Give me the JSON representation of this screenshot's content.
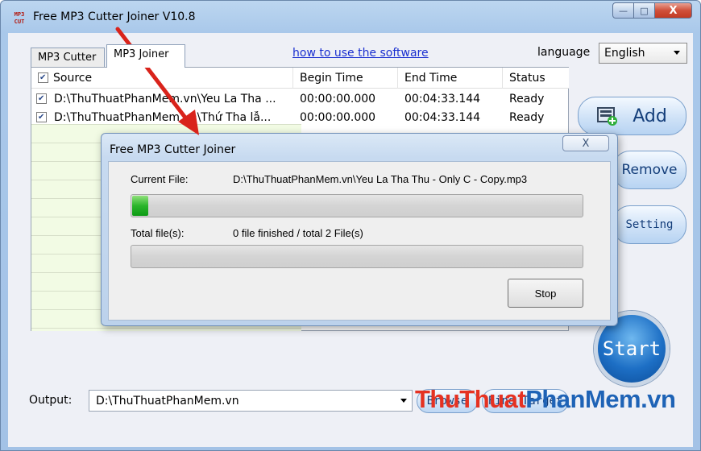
{
  "window": {
    "icon_text": "MP3\nCUT",
    "title": "Free MP3 Cutter Joiner V10.8",
    "controls": {
      "minimize": "—",
      "maximize": "□",
      "close": "X"
    }
  },
  "tabs": [
    {
      "label": "MP3 Cutter",
      "active": false
    },
    {
      "label": "MP3 Joiner",
      "active": true
    }
  ],
  "help_link": "how to use the software",
  "language": {
    "label": "language",
    "value": "English"
  },
  "table": {
    "header_checked": true,
    "columns": [
      "Source",
      "Begin Time",
      "End Time",
      "Status"
    ],
    "rows": [
      {
        "checked": true,
        "source": "D:\\ThuThuatPhanMem.vn\\Yeu La Tha ...",
        "begin": "00:00:00.000",
        "end": "00:04:33.144",
        "status": "Ready"
      },
      {
        "checked": true,
        "source": "D:\\ThuThuatPhanMem.vn\\Thứ Tha lẫ...",
        "begin": "00:00:00.000",
        "end": "00:04:33.144",
        "status": "Ready"
      }
    ]
  },
  "buttons": {
    "add": "Add",
    "remove": "Remove",
    "setting": "Setting",
    "start": "Start",
    "browse": "Browse",
    "find_target": "Find Target"
  },
  "output": {
    "label": "Output:",
    "value": "D:\\ThuThuatPhanMem.vn"
  },
  "dialog": {
    "title": "Free MP3 Cutter Joiner",
    "close": "X",
    "current_file_label": "Current File:",
    "current_file_value": "D:\\ThuThuatPhanMem.vn\\Yeu La Tha Thu - Only C - Copy.mp3",
    "current_progress": 0.035,
    "total_label": "Total file(s):",
    "total_value": "0 file finished / total 2 File(s)",
    "total_progress": 0,
    "stop": "Stop"
  },
  "watermark": {
    "part1": "ThuThuat",
    "part2": "PhanMem.vn"
  },
  "colors": {
    "accent_blue": "#1e63b6",
    "watermark_red": "#e53222",
    "arrow_red": "#d9231b",
    "progress_green": "#2bb52b"
  }
}
